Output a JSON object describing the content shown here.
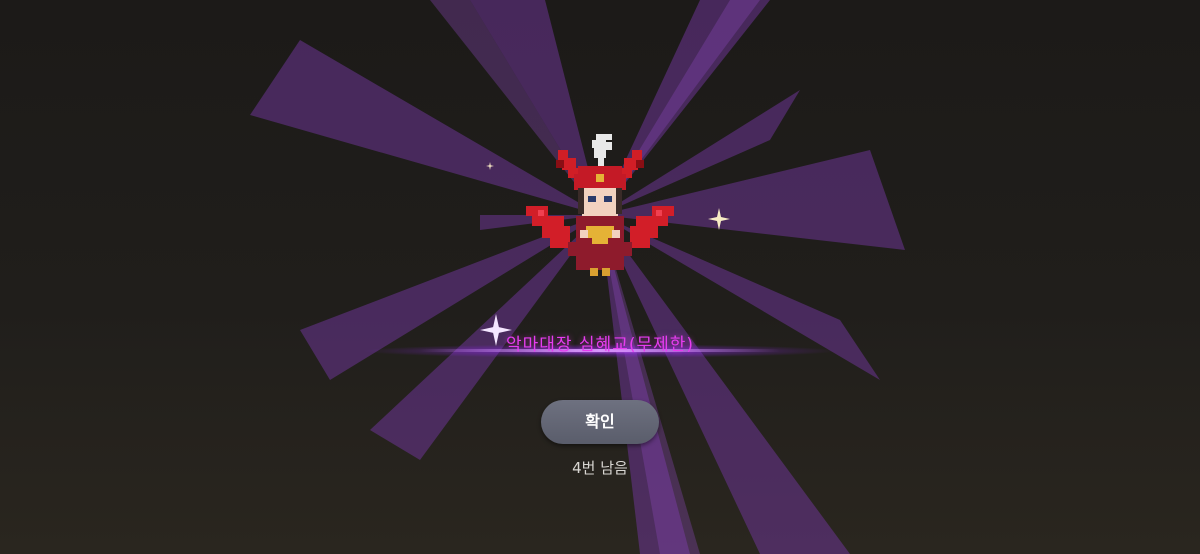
{
  "reward": {
    "item_name": "악마대장 심혜교(무제한)",
    "item_name_color": "#e63cf0",
    "glow_color": "#b45aff"
  },
  "actions": {
    "confirm_label": "확인"
  },
  "status": {
    "remaining_text": "4번 남음"
  },
  "icons": [
    "demon-character-sprite",
    "sparkle-icon"
  ]
}
